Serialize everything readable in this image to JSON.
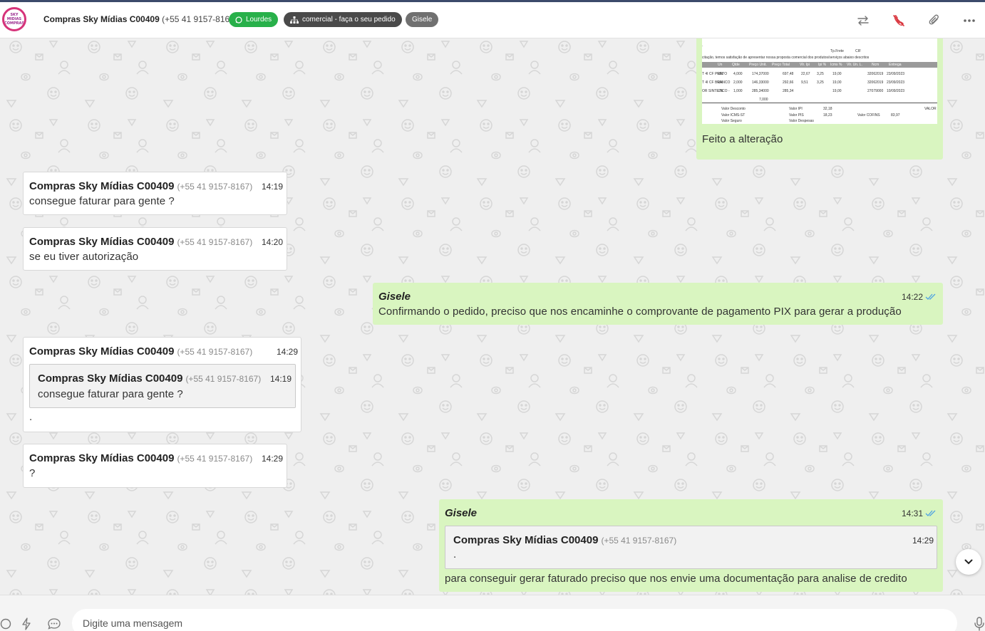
{
  "header": {
    "avatar_text": "SKY MIDIAS COMPRAS",
    "contact_name": "Compras Sky Mídias C00409",
    "contact_phone": "(+55 41 9157-8167)",
    "tags": {
      "channel": "Lourdes",
      "department": "comercial - faça o seu pedido",
      "agent": "Gisele"
    },
    "icons": [
      "transfer-icon",
      "end-call-icon",
      "attachment-icon",
      "more-icon"
    ]
  },
  "colors": {
    "accent_green": "#28b04a",
    "outgoing_bubble": "#d9f5c0",
    "incoming_bubble": "#ffffff",
    "read_ticks": "#4fa3e3"
  },
  "doc_preview": {
    "line1": "citação, temos satisfação de apresentar nossa proposta comercial dos produtos/serviços abaixo descritos",
    "freight_label": "Tp.Frete",
    "freight_value": "CIF",
    "columns": [
      "Un",
      "Qtde",
      "Preço Unit.",
      "Preço Total",
      "Vlr. Ipi",
      "Ipi %",
      "Icms %",
      "Vlr. Un. L.",
      "Ncm",
      "Entrega"
    ],
    "rows": [
      [
        "T 4I CF PRETO",
        "UN",
        "4,000",
        "174,37000",
        "697,48",
        "22,67",
        "3,25",
        "19,00",
        "32062019",
        "23/09/2023"
      ],
      [
        "T 4I CF BRANCO",
        "UN",
        "2,000",
        "146,33000",
        "292,66",
        "9,51",
        "3,25",
        "19,00",
        "32062019",
        "23/09/2023"
      ],
      [
        "OR SINTETICO -",
        "UN",
        "1,000",
        "285,34000",
        "285,34",
        "",
        "",
        "19,00",
        "27079000",
        "10/09/2023"
      ]
    ],
    "total_qty": "7,000",
    "summary": [
      "Valor Desconto",
      "Valor IPI",
      "32,18",
      "Valor ICMS-ST",
      "Valor PIS",
      "18,23",
      "Valor COFINS",
      "83,97",
      "Valor Seguro",
      "Valor Despesas",
      "VALOR"
    ]
  },
  "messages": [
    {
      "id": "m1",
      "direction": "out",
      "caption": "Feito a alteração"
    },
    {
      "id": "m2",
      "direction": "in",
      "sender": "Compras Sky Mídias C00409",
      "phone": "(+55 41 9157-8167)",
      "time": "14:19",
      "text": "consegue faturar para gente ?"
    },
    {
      "id": "m3",
      "direction": "in",
      "sender": "Compras Sky Mídias C00409",
      "phone": "(+55 41 9157-8167)",
      "time": "14:20",
      "text": "se eu tiver autorização"
    },
    {
      "id": "m4",
      "direction": "out",
      "sender": "Gisele",
      "time": "14:22",
      "text": "Confirmando o pedido, preciso que nos encaminhe o comprovante de pagamento PIX para gerar a produção"
    },
    {
      "id": "m5",
      "direction": "in",
      "sender": "Compras Sky Mídias C00409",
      "phone": "(+55 41 9157-8167)",
      "time": "14:29",
      "quote": {
        "sender": "Compras Sky Mídias C00409",
        "phone": "(+55 41 9157-8167)",
        "time": "14:19",
        "text": "consegue faturar para gente ?"
      },
      "text": "."
    },
    {
      "id": "m6",
      "direction": "in",
      "sender": "Compras Sky Mídias C00409",
      "phone": "(+55 41 9157-8167)",
      "time": "14:29",
      "text": "?"
    },
    {
      "id": "m7",
      "direction": "out",
      "sender": "Gisele",
      "time": "14:31",
      "quote": {
        "sender": "Compras Sky Mídias C00409",
        "phone": "(+55 41 9157-8167)",
        "time": "14:29",
        "text": "."
      },
      "text": "para conseguir gerar faturado preciso que nos envie uma documentação para analise de credito"
    }
  ],
  "composer": {
    "placeholder": "Digite uma mensagem"
  }
}
